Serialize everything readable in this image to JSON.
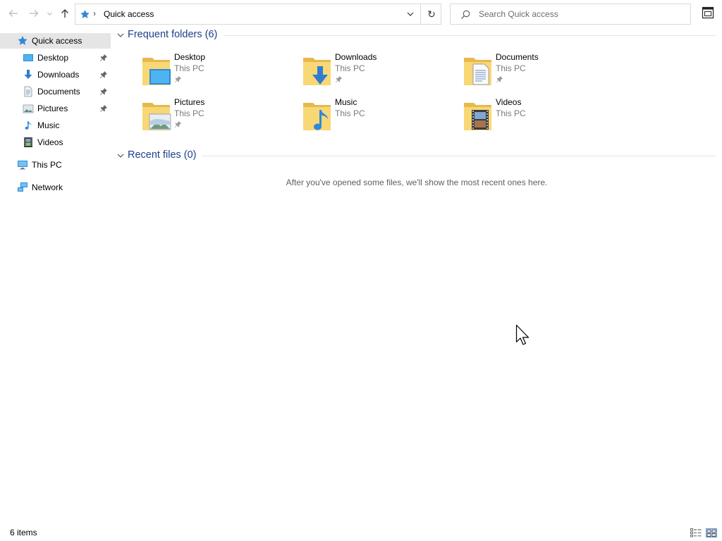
{
  "address": {
    "separator": "›",
    "crumb": "Quick access",
    "refresh_glyph": "↻"
  },
  "search": {
    "placeholder": "Search Quick access"
  },
  "sidebar": {
    "items": [
      {
        "label": "Quick access",
        "icon": "quick-access-star-icon",
        "selected": true
      },
      {
        "label": "Desktop",
        "icon": "desktop-icon",
        "pinned": true
      },
      {
        "label": "Downloads",
        "icon": "downloads-icon",
        "pinned": true
      },
      {
        "label": "Documents",
        "icon": "documents-icon",
        "pinned": true
      },
      {
        "label": "Pictures",
        "icon": "pictures-icon",
        "pinned": true
      },
      {
        "label": "Music",
        "icon": "music-icon"
      },
      {
        "label": "Videos",
        "icon": "videos-icon"
      },
      {
        "label": "This PC",
        "icon": "this-pc-icon"
      },
      {
        "label": "Network",
        "icon": "network-icon"
      }
    ]
  },
  "frequent": {
    "header": "Frequent folders (6)",
    "folders": [
      {
        "name": "Desktop",
        "location": "This PC",
        "pinned": true
      },
      {
        "name": "Downloads",
        "location": "This PC",
        "pinned": true
      },
      {
        "name": "Documents",
        "location": "This PC",
        "pinned": true
      },
      {
        "name": "Pictures",
        "location": "This PC",
        "pinned": true
      },
      {
        "name": "Music",
        "location": "This PC",
        "pinned": false
      },
      {
        "name": "Videos",
        "location": "This PC",
        "pinned": false
      }
    ]
  },
  "recent": {
    "header": "Recent files (0)",
    "empty_message": "After you've opened some files, we'll show the most recent ones here."
  },
  "status": {
    "item_count": "6 items"
  },
  "colors": {
    "accent_blue": "#1e3f8a",
    "folder_yellow": "#f8d775",
    "selection": "#e5e5e5",
    "icon_blue": "#2e8ad8"
  }
}
